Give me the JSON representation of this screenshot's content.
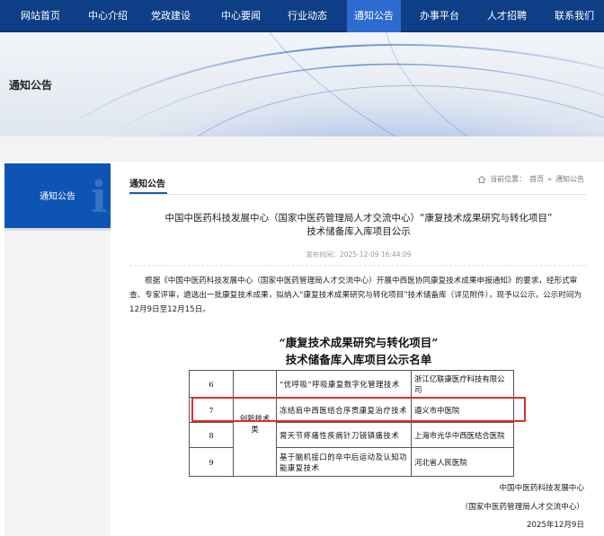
{
  "nav": {
    "items": [
      {
        "label": "网站首页"
      },
      {
        "label": "中心介绍"
      },
      {
        "label": "党政建设"
      },
      {
        "label": "中心要闻"
      },
      {
        "label": "行业动态"
      },
      {
        "label": "通知公告",
        "active": true
      },
      {
        "label": "办事平台"
      },
      {
        "label": "人才招聘"
      },
      {
        "label": "联系我们"
      }
    ]
  },
  "banner": {
    "title": "通知公告"
  },
  "sidebar": {
    "current": "通知公告"
  },
  "content": {
    "tab": "通知公告",
    "breadcrumb": {
      "prefix": "当前位置：",
      "home": "首页",
      "sep": "»",
      "current": "通知公告"
    },
    "title_line1": "中国中医药科技发展中心（国家中医药管理局人才交流中心）“康复技术成果研究与转化项目”",
    "title_line2": "技术储备库入库项目公示",
    "publish_time": "发布时间：2025-12-09 16:44:09",
    "body": "根据《中国中医药科技发展中心（国家中医药管理局人才交流中心）开展中西医协同康复技术成果申报通知》的要求，经形式审查、专家评审，遴选出一批康复技术成果，拟纳入“康复技术成果研究与转化项目”技术储备库（详见附件），现予以公示，公示时间为12月9日至12月15日。",
    "doc_title_line1": "“康复技术成果研究与转化项目”",
    "doc_title_line2": "技术储备库入库项目公示名单",
    "table": {
      "category": "创新技术类",
      "rows": [
        {
          "no": "6",
          "name": "“优呼吸”呼吸康复数字化管理技术",
          "org": "浙江亿联康医疗科技有限公司"
        },
        {
          "no": "7",
          "name": "冻结肩中西医结合序贯康复治疗技术",
          "org": "遵义市中医院"
        },
        {
          "no": "8",
          "name": "膏天节疼痛性疾病针刀镜镇痛技术",
          "org": "上海市光华中西医结合医院"
        },
        {
          "no": "9",
          "name": "基于脑机接口的卒中后运动及认知功能康复技术",
          "org": "河北省人民医院"
        }
      ]
    },
    "sign": {
      "org1": "中国中医药科技发展中心",
      "org2": "（国家中医药管理局人才交流中心）",
      "date": "2025年12月9日"
    }
  },
  "colors": {
    "nav": "#0e3f86",
    "nav_active": "#2e6bd0",
    "sidebar_head": "#0d54b4",
    "highlight": "#d9302b"
  }
}
